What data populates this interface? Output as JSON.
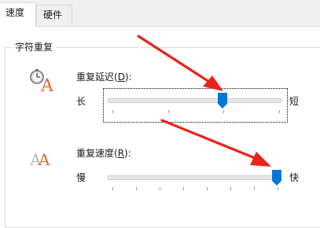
{
  "tabs": [
    {
      "label": "速度",
      "active": true
    },
    {
      "label": "硬件",
      "active": false
    }
  ],
  "group": {
    "title": "字符重复"
  },
  "repeat_delay": {
    "label_text": "重复延迟(",
    "label_key": "D",
    "label_suffix": "):",
    "min_label": "长",
    "max_label": "短",
    "value_fraction": 0.65
  },
  "repeat_rate": {
    "label_text": "重复速度(",
    "label_key": "R",
    "label_suffix": "):",
    "min_label": "慢",
    "max_label": "快",
    "value_fraction": 1.0
  },
  "colors": {
    "accent": "#0078d7",
    "arrow": "#e8231b",
    "icon_letter": "#e26a2c"
  }
}
